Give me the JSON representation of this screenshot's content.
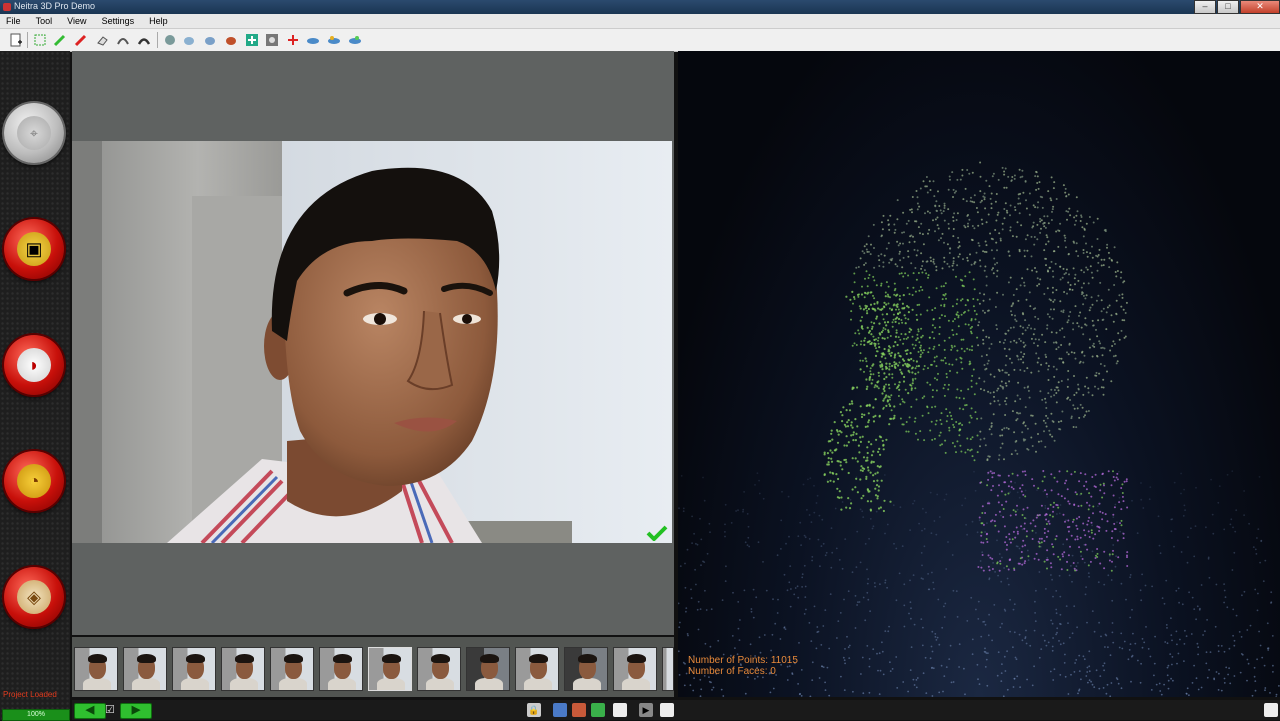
{
  "window": {
    "title": "Neitra 3D Pro Demo"
  },
  "menu": {
    "items": [
      "File",
      "Tool",
      "View",
      "Settings",
      "Help"
    ]
  },
  "window_buttons": {
    "minimize": "–",
    "maximize": "□",
    "close": "✕"
  },
  "toolbar": {
    "icons": [
      "new-project-icon",
      "select-icon",
      "pen-green-icon",
      "pen-red-icon",
      "eraser-icon",
      "arc-icon",
      "arc2-icon",
      "mesh-icon",
      "hand-icon",
      "hand2-icon",
      "bug-icon",
      "add-icon",
      "camera-icon",
      "cross-icon",
      "fish-icon",
      "fish2-icon",
      "fish3-icon"
    ]
  },
  "sidebar": {
    "buttons": [
      {
        "name": "target-orb-button",
        "glyph": "⌖",
        "enabled": false
      },
      {
        "name": "cube-orb-button",
        "glyph": "▣"
      },
      {
        "name": "mask-orb-button",
        "glyph": "◗"
      },
      {
        "name": "pac-orb-button",
        "glyph": "◔"
      },
      {
        "name": "box-orb-button",
        "glyph": "◈"
      }
    ],
    "status": "Project Loaded",
    "progress": "100%",
    "progress_value": 1.0
  },
  "viewer": {
    "points_label": "Number of Points: 11015",
    "faces_label": "Number of Faces: 0"
  },
  "filmstrip": {
    "count": 13,
    "selected_index": 6
  },
  "bottom": {
    "prev_label": "◀",
    "next_label": "▶",
    "checkbox": "☑"
  },
  "colors": {
    "sidebar_orb": "#c8100a",
    "point_green": "#7cc85a",
    "point_purple": "#b36ad8",
    "status_red": "#e23b1e",
    "overlay_text": "#e98a3a"
  }
}
